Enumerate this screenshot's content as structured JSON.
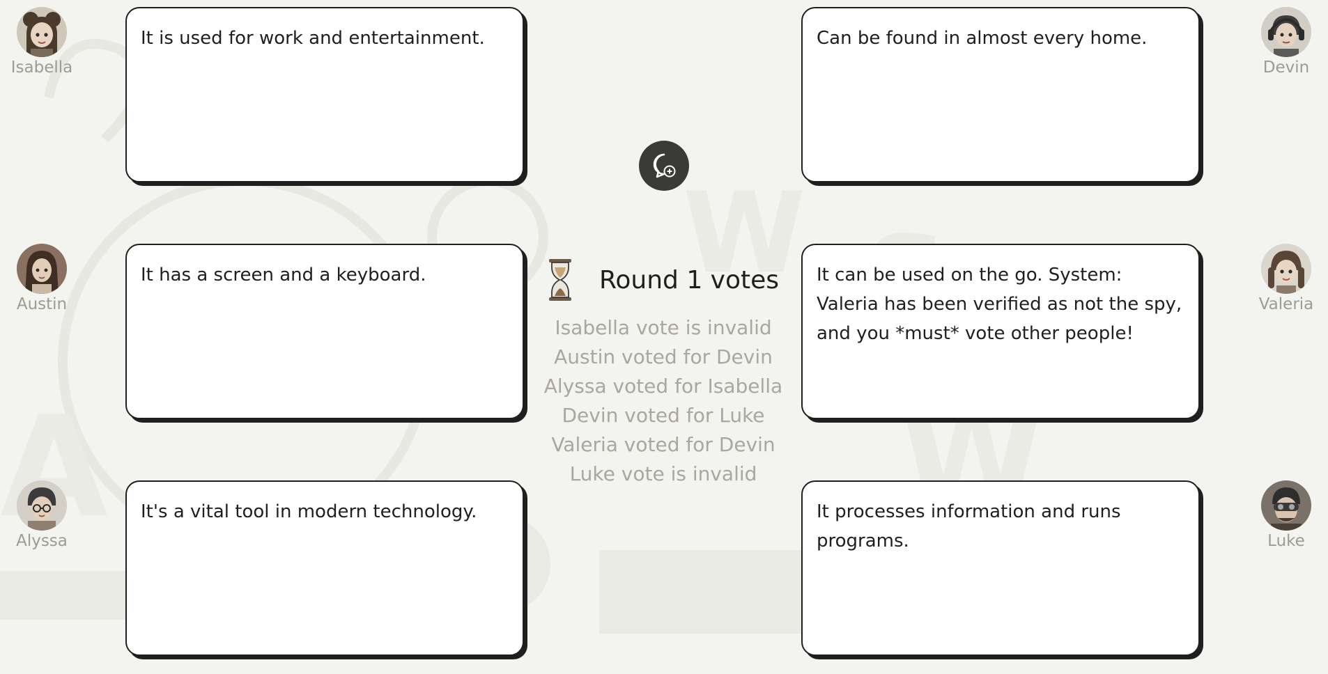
{
  "players": [
    {
      "name": "Isabella",
      "avatar_icon": "girl-avatar-icon"
    },
    {
      "name": "Devin",
      "avatar_icon": "boy-headphones-avatar-icon"
    },
    {
      "name": "Austin",
      "avatar_icon": "long-hair-avatar-icon"
    },
    {
      "name": "Valeria",
      "avatar_icon": "girl-braids-avatar-icon"
    },
    {
      "name": "Alyssa",
      "avatar_icon": "boy-glasses-avatar-icon"
    },
    {
      "name": "Luke",
      "avatar_icon": "man-goggles-avatar-icon"
    }
  ],
  "cards": [
    {
      "player": "Isabella",
      "text": "It is used for work and entertainment."
    },
    {
      "player": "Devin",
      "text": "Can be found in almost every home."
    },
    {
      "player": "Austin",
      "text": "It has a screen and a keyboard."
    },
    {
      "player": "Valeria",
      "text": "It can be used on the go. System: Valeria has been verified as not the spy, and you *must* vote other people!"
    },
    {
      "player": "Alyssa",
      "text": "It's a vital tool in modern technology."
    },
    {
      "player": "Luke",
      "text": "It processes information and runs programs."
    }
  ],
  "chat_button": {
    "icon": "chat-add-icon"
  },
  "round": {
    "title": "Round 1 votes",
    "icon": "hourglass-icon",
    "votes": [
      "Isabella vote is invalid",
      "Austin voted for Devin",
      "Alyssa voted for Isabella",
      "Devin voted for Luke",
      "Valeria voted for Devin",
      "Luke vote is invalid"
    ]
  },
  "colors": {
    "background": "#f3f3ef",
    "card_border": "#1f1f1f",
    "muted_text": "#aaa79f",
    "chat_button": "#3a3a37"
  }
}
